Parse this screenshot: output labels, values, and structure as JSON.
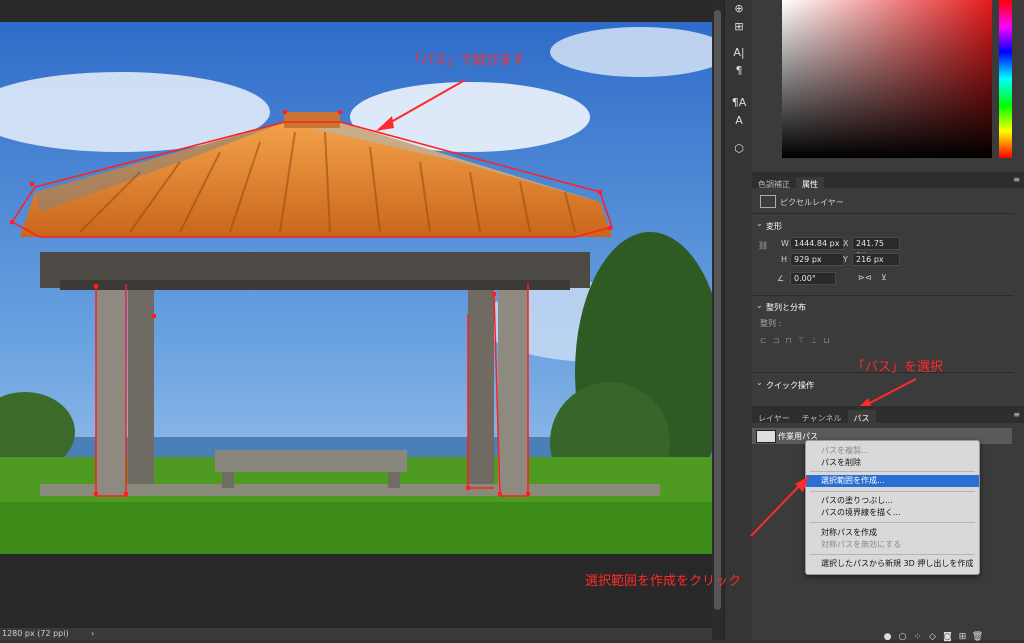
{
  "canvas": {
    "status_text": "1280 px (72 ppi)",
    "status_arrow": "›"
  },
  "annotations": {
    "top": "「パス」で結びます",
    "right": "「パス」を選択",
    "bottom": "選択範囲を作成をクリック",
    "color": "#ff2a2a"
  },
  "tools": [
    {
      "icon": "stamp-icon",
      "glyph": "⊕"
    },
    {
      "icon": "text-tool-icon",
      "glyph": "A|"
    },
    {
      "icon": "paragraph-icon",
      "glyph": "¶"
    },
    {
      "icon": "paragraph-style-icon",
      "glyph": "¶A"
    },
    {
      "icon": "3d-cube-icon",
      "glyph": "⬡"
    }
  ],
  "properties": {
    "tabs": [
      "色調補正",
      "属性"
    ],
    "layer_type": "ピクセルレイヤー",
    "transform_title": "変形",
    "w_label": "W",
    "w_value": "1444.84 px",
    "x_label": "X",
    "x_value": "241.75 px",
    "h_label": "H",
    "h_value": "929 px",
    "y_label": "Y",
    "y_value": "216 px",
    "angle_value": "0.00°",
    "align_title": "整列と分布",
    "align_sub": "整列 :",
    "quick_title": "クイック操作"
  },
  "paths_panel": {
    "tabs": [
      "レイヤー",
      "チャンネル",
      "パス"
    ],
    "path_name": "作業用パス"
  },
  "context_menu": {
    "items": [
      {
        "label": "パスを複製...",
        "state": "disabled"
      },
      {
        "label": "パスを削除",
        "state": "normal"
      },
      {
        "label": "選択範囲を作成...",
        "state": "selected"
      },
      {
        "label": "パスの塗りつぶし...",
        "state": "normal"
      },
      {
        "label": "パスの境界線を描く...",
        "state": "normal"
      },
      {
        "label": "対称パスを作成",
        "state": "normal"
      },
      {
        "label": "対称パスを無効にする",
        "state": "disabled"
      },
      {
        "label": "選択したパスから新規 3D 押し出しを作成",
        "state": "normal"
      }
    ]
  },
  "bottom_icons": [
    "fill-circle-icon",
    "stroke-circle-icon",
    "selection-to-path-icon",
    "path-from-selection-icon",
    "mask-icon",
    "new-path-icon",
    "trash-icon"
  ]
}
